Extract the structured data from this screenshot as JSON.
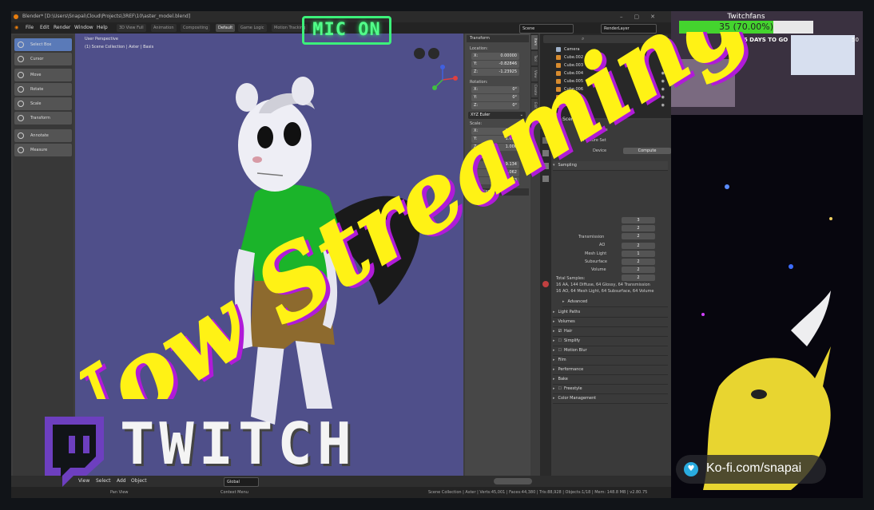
{
  "blender": {
    "title": "Blender* [D:\\Users\\Snapai\\Cloud\\Projects\\3REF\\10\\aster_model.blend]",
    "menu": [
      "File",
      "Edit",
      "Render",
      "Window",
      "Help"
    ],
    "workspace_tabs": [
      "3D View Full",
      "Animation",
      "Compositing",
      "Default",
      "Game Logic",
      "Motion Tracking"
    ],
    "active_tab": "Default",
    "scene_field": "Scene",
    "renderlayer_field": "RenderLayer",
    "viewport": {
      "label": "User Perspective",
      "collection": "(1) Scene Collection | Aster | Basis"
    },
    "tools": [
      "Select Box",
      "Cursor",
      "Move",
      "Rotate",
      "Scale",
      "Transform",
      "Annotate",
      "Measure"
    ],
    "npanel": {
      "header": "Transform",
      "location_label": "Location:",
      "location": [
        {
          "k": "X:",
          "v": "0.00000"
        },
        {
          "k": "Y:",
          "v": "-0.82846"
        },
        {
          "k": "Z:",
          "v": "-1.23925"
        }
      ],
      "rotation_label": "Rotation:",
      "rotation": [
        {
          "k": "X:",
          "v": "0°"
        },
        {
          "k": "Y:",
          "v": "0°"
        },
        {
          "k": "Z:",
          "v": "0°"
        }
      ],
      "euler": "XYZ Euler",
      "scale_label": "Scale:",
      "scale": [
        {
          "k": "X:",
          "v": "1.000"
        },
        {
          "k": "Y:",
          "v": "1.000"
        },
        {
          "k": "Z:",
          "v": "1.000"
        }
      ],
      "dimensions_label": "Dimensions:",
      "dimensions": [
        {
          "k": "X:",
          "v": "9.134"
        },
        {
          "k": "Y:",
          "v": "9.062"
        },
        {
          "k": "Z:",
          "v": "18.663"
        }
      ],
      "properties_label": "Properties",
      "tabs": [
        "Item",
        "Tool",
        "View",
        "Create",
        "Edit"
      ]
    },
    "outliner": [
      "Camera",
      "Cube.002",
      "Cube.003",
      "Cube.004",
      "Cube.005",
      "Cube.006",
      "Cube.007",
      "Cube.008"
    ],
    "properties": {
      "scene": "Scene",
      "render_engine_label": "Render Engine",
      "feature_set_label": "Feature Set",
      "device_label": "Device",
      "device_value": "Compute",
      "sampling": "Sampling",
      "rows": [
        {
          "label": "",
          "value": "3"
        },
        {
          "label": "",
          "value": "2"
        },
        {
          "label": "",
          "value": "2"
        },
        {
          "label": "Transmission",
          "value": "2"
        },
        {
          "label": "AO",
          "value": "1"
        },
        {
          "label": "Mesh Light",
          "value": "2"
        },
        {
          "label": "Subsurface",
          "value": "2"
        },
        {
          "label": "Volume",
          "value": "2"
        }
      ],
      "total_samples": "Total Samples:",
      "total_line1": "16 AA, 144 Diffuse, 64 Glossy, 64 Transmission",
      "total_line2": "16 AO, 64 Mesh Light, 64 Subsurface, 64 Volume",
      "advanced": "Advanced",
      "panels": [
        "Light Paths",
        "Volumes",
        "Hair",
        "Simplify",
        "Motion Blur",
        "Film",
        "Performance",
        "Bake",
        "Freestyle",
        "Color Management"
      ]
    },
    "footer": [
      "View",
      "Select",
      "Add",
      "Object",
      "Global"
    ],
    "status": {
      "left": "Pan View",
      "mid": "Context Menu",
      "right": "Scene Collection | Aster | Verts:45,001 | Faces:44,380 | Tris:88,928 | Objects:1/18 | Mem: 148.8 MB | v2.80.75"
    }
  },
  "stream": {
    "follower_title": "Twitchfans",
    "follower_count": "35 (70.00%)",
    "follower_progress": 0.7,
    "days_to_go": "96 DAYS TO GO",
    "goal_number": "50",
    "mic": "MIC ON",
    "headline": "Now Streaming!",
    "brand": "TWITCH",
    "kofi": "Ko-fi.com/snapai"
  },
  "colors": {
    "headline_fill": "#fff215",
    "headline_shadow": "#b01bd8",
    "twitch_purple": "#6d3fbf",
    "mic_green": "#3cf07a",
    "follower_green": "#44d42e"
  }
}
